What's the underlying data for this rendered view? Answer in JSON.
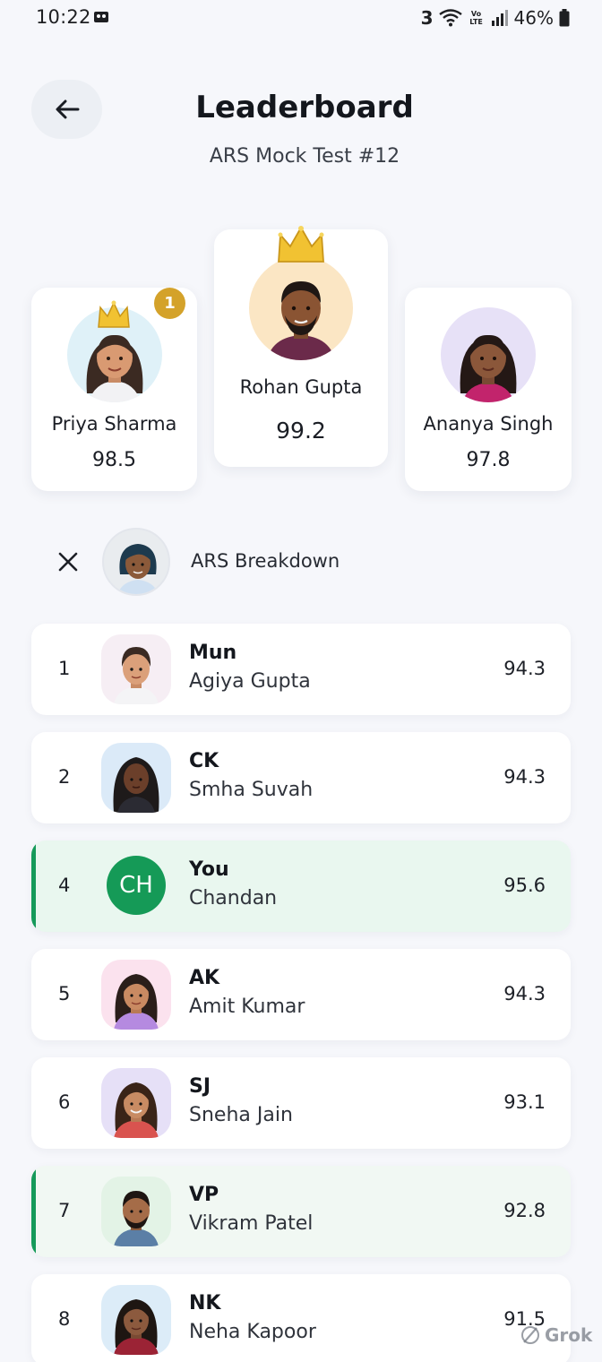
{
  "status_bar": {
    "time": "10:22",
    "carrier": "3",
    "volte": "Vo LTE",
    "battery": "46%"
  },
  "header": {
    "title": "Leaderboard",
    "subtitle": "ARS Mock Test #12"
  },
  "podium": {
    "left": {
      "name": "Priya Sharma",
      "score": "98.5",
      "badge": "1"
    },
    "center": {
      "name": "Rohan Gupta",
      "score": "99.2"
    },
    "right": {
      "name": "Ananya Singh",
      "score": "97.8"
    }
  },
  "breakdown": {
    "label": "ARS Breakdown"
  },
  "rows": [
    {
      "rank": "1",
      "handle": "Mun",
      "name": "Agiya Gupta",
      "score": "94.3"
    },
    {
      "rank": "2",
      "handle": "CK",
      "name": "Smha Suvah",
      "score": "94.3"
    },
    {
      "rank": "4",
      "handle": "You",
      "name": "Chandan",
      "score": "95.6",
      "initials": "CH"
    },
    {
      "rank": "5",
      "handle": "AK",
      "name": "Amit Kumar",
      "score": "94.3"
    },
    {
      "rank": "6",
      "handle": "SJ",
      "name": "Sneha Jain",
      "score": "93.1"
    },
    {
      "rank": "7",
      "handle": "VP",
      "name": "Vikram Patel",
      "score": "92.8"
    },
    {
      "rank": "8",
      "handle": "NK",
      "name": "Neha Kapoor",
      "score": "91.5"
    }
  ],
  "watermark": "Grok",
  "colors": {
    "accent_green": "#169a5a",
    "highlight_green": "#e9f7ef",
    "gold_badge": "#d4a22a",
    "background": "#f6f7fb"
  }
}
